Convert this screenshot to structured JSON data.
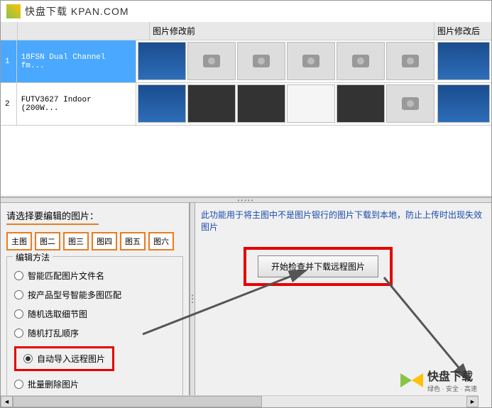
{
  "titlebar": {
    "text": "快盘下载 KPAN.COM"
  },
  "headers": {
    "before": "图片修改前",
    "after": "图片修改后"
  },
  "rows": [
    {
      "idx": "1",
      "name": "18FSN Dual Channel fm..."
    },
    {
      "idx": "2",
      "name": "FUTV3627 Indoor (200W..."
    }
  ],
  "left": {
    "prompt": "请选择要编辑的图片：",
    "buttons": [
      "主图",
      "图二",
      "图三",
      "图四",
      "图五",
      "图六"
    ],
    "legend": "编辑方法",
    "radios": {
      "r1": "智能匹配图片文件名",
      "r2": "按产品型号智能多图匹配",
      "r3": "随机选取细节图",
      "r4": "随机打乱顺序",
      "r5": "自动导入远程图片",
      "r6": "批量删除图片"
    }
  },
  "right": {
    "info": "此功能用于将主图中不是图片银行的图片下载到本地，防止上传时出现失效图片",
    "action": "开始检查并下载远程图片"
  },
  "watermark": {
    "title": "快盘下载",
    "sub": "绿色 · 安全 · 高速"
  }
}
